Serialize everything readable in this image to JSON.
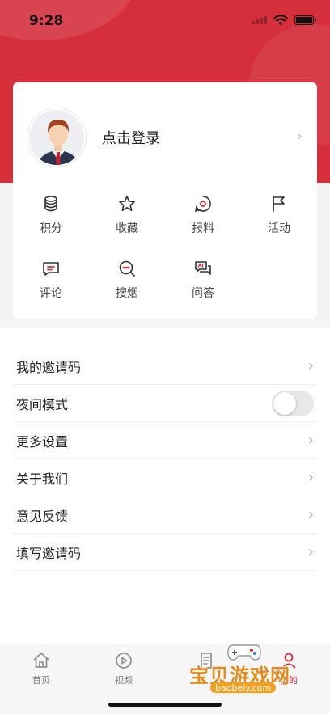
{
  "status_bar": {
    "time": "9:28"
  },
  "profile": {
    "login_label": "点击登录"
  },
  "grid": [
    {
      "label": "积分",
      "icon": "database-icon"
    },
    {
      "label": "收藏",
      "icon": "star-icon"
    },
    {
      "label": "报料",
      "icon": "report-icon"
    },
    {
      "label": "活动",
      "icon": "flag-icon"
    },
    {
      "label": "评论",
      "icon": "comment-icon"
    },
    {
      "label": "搜烟",
      "icon": "search-icon"
    },
    {
      "label": "问答",
      "icon": "qa-icon"
    }
  ],
  "settings": [
    {
      "label": "我的邀请码"
    },
    {
      "label": "夜间模式",
      "toggle": false
    },
    {
      "label": "更多设置"
    },
    {
      "label": "关于我们"
    },
    {
      "label": "意见反馈"
    },
    {
      "label": "填写邀请码"
    }
  ],
  "tabs": [
    {
      "label": "首页",
      "icon": "home-icon",
      "active": false
    },
    {
      "label": "视频",
      "icon": "play-icon",
      "active": false
    },
    {
      "label": "",
      "icon": "document-icon",
      "active": false
    },
    {
      "label": "我的",
      "icon": "person-icon",
      "active": true
    }
  ],
  "watermark": {
    "text": "宝贝游戏网",
    "url": "baobeiy.com"
  },
  "colors": {
    "brand_red": "#d42f3b"
  }
}
